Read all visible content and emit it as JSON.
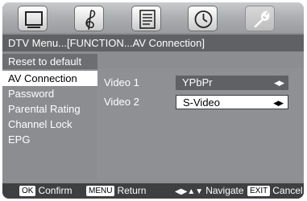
{
  "icon_bar": {
    "icons": [
      {
        "name": "picture-icon"
      },
      {
        "name": "sound-icon"
      },
      {
        "name": "function-icon"
      },
      {
        "name": "time-icon"
      },
      {
        "name": "setup-icon"
      }
    ]
  },
  "title": "DTV Menu...[FUNCTION...AV Connection]",
  "sidebar": {
    "items": [
      {
        "label": "Reset to default"
      },
      {
        "label": "AV Connection"
      },
      {
        "label": "Password"
      },
      {
        "label": "Parental Rating"
      },
      {
        "label": "Channel Lock"
      },
      {
        "label": "EPG"
      }
    ]
  },
  "settings": [
    {
      "label": "Video 1",
      "value": "YPbPr"
    },
    {
      "label": "Video 2",
      "value": "S-Video"
    }
  ],
  "arrow_glyph": "◀▶",
  "bottom_bar": {
    "confirm": {
      "key": "OK",
      "label": "Confirm"
    },
    "return": {
      "key": "MENU",
      "label": "Return"
    },
    "navigate": {
      "symbol": "◀▶▲▼",
      "label": "Navigate"
    },
    "cancel": {
      "key": "EXIT",
      "label": "Cancel"
    }
  }
}
